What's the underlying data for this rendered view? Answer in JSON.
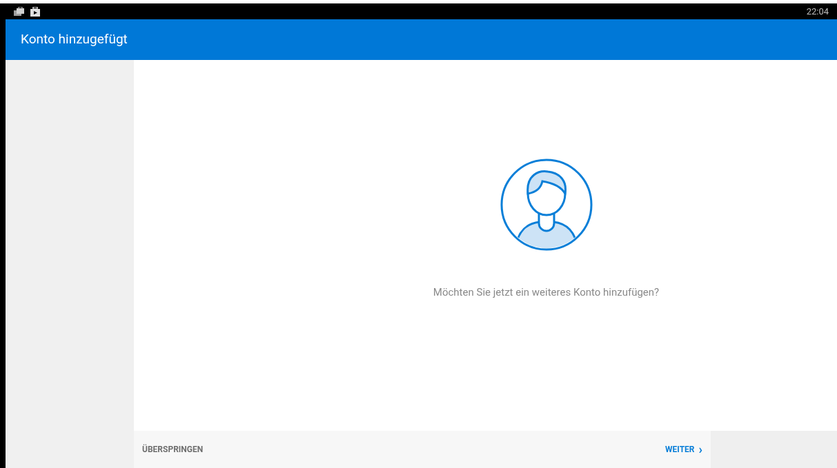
{
  "status_bar": {
    "time": "22:04"
  },
  "app_bar": {
    "title": "Konto hinzugefügt"
  },
  "content": {
    "question": "Möchten Sie jetzt ein weiteres Konto hinzufügen?"
  },
  "footer": {
    "skip_label": "ÜBERSPRINGEN",
    "next_label": "WEITER",
    "next_arrow": "›"
  }
}
